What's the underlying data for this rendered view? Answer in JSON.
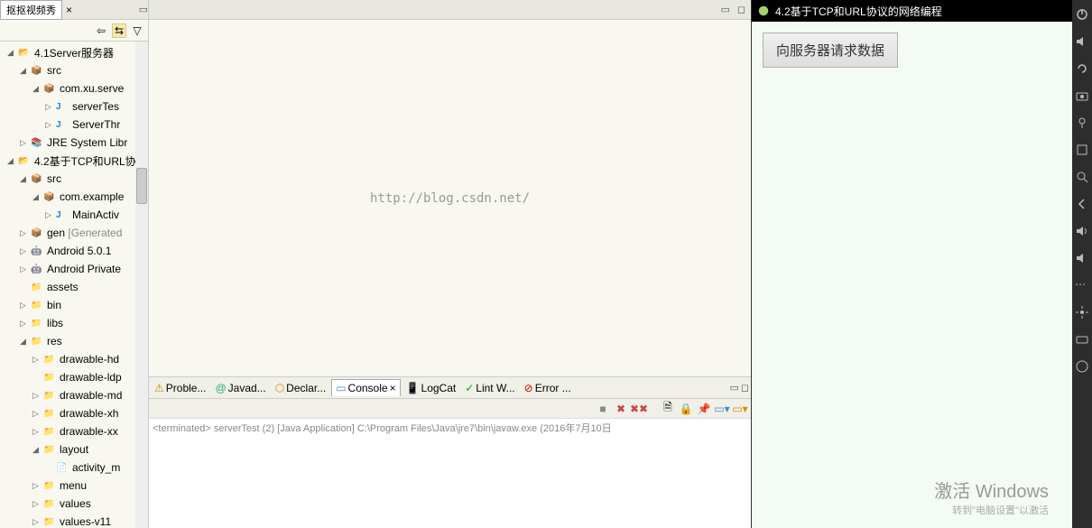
{
  "leftTab": {
    "label": "抠抠视频秀",
    "close": "×"
  },
  "toolbarIcons": [
    "collapse",
    "link",
    "menu"
  ],
  "tree": [
    {
      "depth": 0,
      "arrow": "◢",
      "icon": "proj-icon",
      "label": "4.1Server服务器"
    },
    {
      "depth": 1,
      "arrow": "◢",
      "icon": "package-icon",
      "label": "src"
    },
    {
      "depth": 2,
      "arrow": "◢",
      "icon": "package-icon",
      "label": "com.xu.serve"
    },
    {
      "depth": 3,
      "arrow": "▷",
      "icon": "java-icon",
      "label": "serverTes"
    },
    {
      "depth": 3,
      "arrow": "▷",
      "icon": "java-icon",
      "label": "ServerThr"
    },
    {
      "depth": 1,
      "arrow": "▷",
      "icon": "lib-icon",
      "label": "JRE System Libr"
    },
    {
      "depth": 0,
      "arrow": "◢",
      "icon": "proj-icon",
      "label": "4.2基于TCP和URL协"
    },
    {
      "depth": 1,
      "arrow": "◢",
      "icon": "package-icon",
      "label": "src"
    },
    {
      "depth": 2,
      "arrow": "◢",
      "icon": "package-icon",
      "label": "com.example"
    },
    {
      "depth": 3,
      "arrow": "▷",
      "icon": "java-icon",
      "label": "MainActiv"
    },
    {
      "depth": 1,
      "arrow": "▷",
      "icon": "package-icon",
      "label": "gen ",
      "suffix": "[Generated"
    },
    {
      "depth": 1,
      "arrow": "▷",
      "icon": "android-icon",
      "label": "Android 5.0.1"
    },
    {
      "depth": 1,
      "arrow": "▷",
      "icon": "android-icon",
      "label": "Android Private"
    },
    {
      "depth": 1,
      "arrow": "",
      "icon": "folder-icon",
      "label": "assets"
    },
    {
      "depth": 1,
      "arrow": "▷",
      "icon": "folder-icon",
      "label": "bin"
    },
    {
      "depth": 1,
      "arrow": "▷",
      "icon": "folder-icon",
      "label": "libs"
    },
    {
      "depth": 1,
      "arrow": "◢",
      "icon": "folder-icon",
      "label": "res"
    },
    {
      "depth": 2,
      "arrow": "▷",
      "icon": "folder-icon",
      "label": "drawable-hd"
    },
    {
      "depth": 2,
      "arrow": "",
      "icon": "folder-icon",
      "label": "drawable-ldp"
    },
    {
      "depth": 2,
      "arrow": "▷",
      "icon": "folder-icon",
      "label": "drawable-md"
    },
    {
      "depth": 2,
      "arrow": "▷",
      "icon": "folder-icon",
      "label": "drawable-xh"
    },
    {
      "depth": 2,
      "arrow": "▷",
      "icon": "folder-icon",
      "label": "drawable-xx"
    },
    {
      "depth": 2,
      "arrow": "◢",
      "icon": "folder-icon",
      "label": "layout"
    },
    {
      "depth": 3,
      "arrow": "",
      "icon": "file-icon",
      "label": "activity_m"
    },
    {
      "depth": 2,
      "arrow": "▷",
      "icon": "folder-icon",
      "label": "menu"
    },
    {
      "depth": 2,
      "arrow": "▷",
      "icon": "folder-icon",
      "label": "values"
    },
    {
      "depth": 2,
      "arrow": "▷",
      "icon": "folder-icon",
      "label": "values-v11"
    }
  ],
  "watermark": "http://blog.csdn.net/",
  "bottomTabs": [
    {
      "label": "Proble...",
      "icon": "⚠",
      "color": "#c80"
    },
    {
      "label": "Javad...",
      "icon": "@",
      "color": "#2a7"
    },
    {
      "label": "Declar...",
      "icon": "⬡",
      "color": "#d80"
    },
    {
      "label": "Console",
      "icon": "▭",
      "color": "#48c",
      "active": true,
      "close": "×"
    },
    {
      "label": "LogCat",
      "icon": "📱",
      "color": "#0a0"
    },
    {
      "label": "Lint W...",
      "icon": "✓",
      "color": "#0a0"
    },
    {
      "label": "Error ...",
      "icon": "⊘",
      "color": "#c00"
    }
  ],
  "consoleText": "<terminated> serverTest (2) [Java Application] C:\\Program Files\\Java\\jre7\\bin\\javaw.exe (2016年7月10日",
  "emulator": {
    "title": "4.2基于TCP和URL协议的网络编程",
    "button": "向服务器请求数据"
  },
  "activate": {
    "title": "激活 Windows",
    "sub": "转到\"电脑设置\"以激活"
  }
}
